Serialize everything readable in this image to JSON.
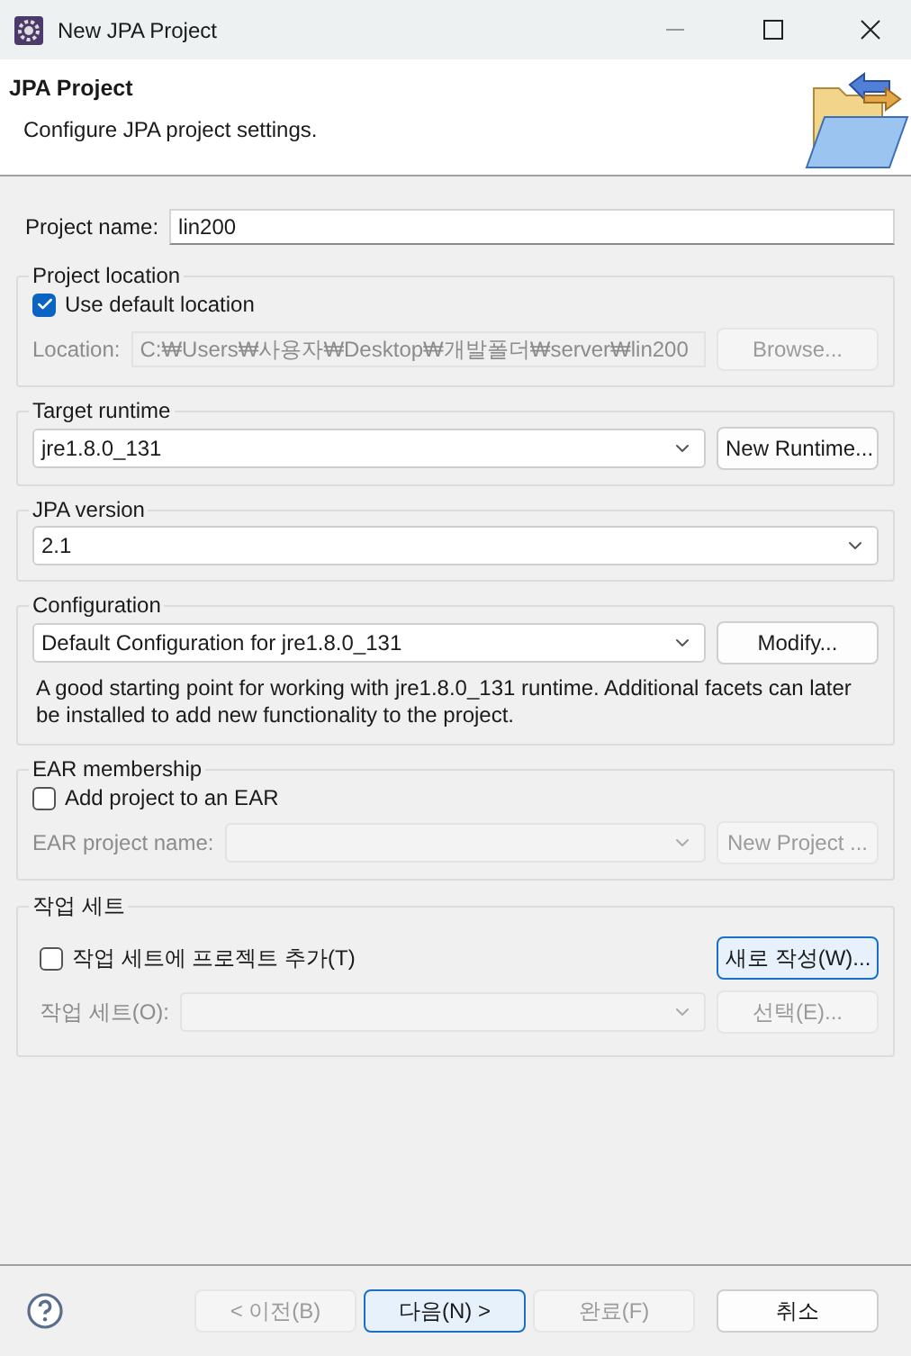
{
  "window": {
    "title": "New JPA Project"
  },
  "header": {
    "title": "JPA Project",
    "description": "Configure JPA project settings."
  },
  "project_name": {
    "label": "Project name:",
    "value": "lin200"
  },
  "project_location": {
    "title": "Project location",
    "use_default": {
      "label": "Use default location",
      "checked": true
    },
    "location": {
      "label": "Location:",
      "value": "C:₩Users₩사용자₩Desktop₩개발폴더₩server₩lin200",
      "disabled": true
    },
    "browse": {
      "label": "Browse...",
      "disabled": true
    }
  },
  "target_runtime": {
    "title": "Target runtime",
    "value": "jre1.8.0_131",
    "button": {
      "label": "New Runtime..."
    }
  },
  "jpa_version": {
    "title": "JPA version",
    "value": "2.1"
  },
  "configuration": {
    "title": "Configuration",
    "value": "Default Configuration for jre1.8.0_131",
    "button": {
      "label": "Modify..."
    },
    "description": "A good starting point for working with jre1.8.0_131 runtime. Additional facets can later be installed to add new functionality to the project."
  },
  "ear_membership": {
    "title": "EAR membership",
    "checkbox": {
      "label": "Add project to an EAR",
      "checked": false
    },
    "field": {
      "label": "EAR project name:",
      "disabled": true
    },
    "button": {
      "label": "New Project ...",
      "disabled": true
    }
  },
  "working_sets": {
    "title": "작업 세트",
    "checkbox": {
      "label": "작업 세트에 프로젝트 추가(T)",
      "checked": false
    },
    "new_button": {
      "label": "새로 작성(W)...",
      "focused": true
    },
    "field": {
      "label": "작업 세트(O):",
      "disabled": true
    },
    "select_button": {
      "label": "선택(E)...",
      "disabled": true
    }
  },
  "buttons": [
    {
      "label": "< 이전(B)",
      "disabled": true,
      "focused": false
    },
    {
      "label": "다음(N) >",
      "disabled": false,
      "focused": true
    },
    {
      "label": "완료(F)",
      "disabled": true,
      "focused": false
    },
    {
      "label": "취소",
      "disabled": false,
      "focused": false
    }
  ]
}
